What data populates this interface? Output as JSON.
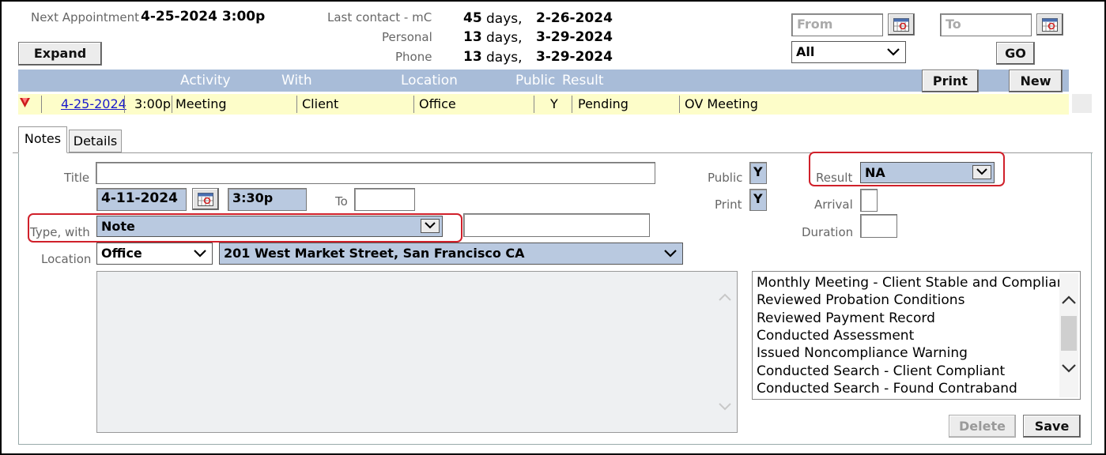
{
  "summary": {
    "next_appt_label": "Next Appointment",
    "next_appt_value": "4-25-2024 3:00p",
    "last_contact_label": "Last contact - mC",
    "last_contact_days": "45",
    "last_contact_date": "2-26-2024",
    "personal_label": "Personal",
    "personal_days": "13",
    "personal_date": "3-29-2024",
    "phone_label": "Phone",
    "phone_days": "13",
    "phone_date": "3-29-2024",
    "days_unit": "days,"
  },
  "toolbar": {
    "expand_label": "Expand",
    "from_placeholder": "From",
    "to_placeholder": "To",
    "filter_value": "All",
    "go_label": "GO",
    "print_label": "Print",
    "new_label": "New"
  },
  "table": {
    "headers": [
      "Activity",
      "With",
      "Location",
      "Public",
      "Result"
    ],
    "row": {
      "date": "4-25-2024",
      "time": "3:00p",
      "activity": "Meeting",
      "with": "Client",
      "location": "Office",
      "public": "Y",
      "result": "Pending",
      "type": "OV Meeting"
    }
  },
  "tabs": [
    {
      "label": "Notes"
    },
    {
      "label": "Details"
    }
  ],
  "form": {
    "title_label": "Title",
    "title_value": "",
    "date_value": "4-11-2024",
    "time_value": "3:30p",
    "to_label": "To",
    "to_value": "",
    "type_label": "Type, with",
    "type_value": "Note",
    "with_value": "",
    "location_label": "Location",
    "location_value": "Office",
    "address_value": "201 West Market Street, San Francisco CA",
    "public_label": "Public",
    "public_value": "Y",
    "print_label": "Print",
    "print_value": "Y",
    "result_label": "Result",
    "result_value": "NA",
    "arrival_label": "Arrival",
    "duration_label": "Duration",
    "notes_value": ""
  },
  "quick_notes": [
    "Monthly Meeting - Client Stable and Compliant",
    "Reviewed Probation Conditions",
    "Reviewed Payment Record",
    "Conducted Assessment",
    "Issued Noncompliance Warning",
    "Conducted Search - Client Compliant",
    "Conducted Search - Found Contraband"
  ],
  "actions": {
    "delete_label": "Delete",
    "save_label": "Save"
  },
  "colors": {
    "header_bar": "#a8bcd8",
    "selected_row": "#fdfdc9",
    "highlight_box": "#d0202a",
    "link": "#1a1acc"
  }
}
